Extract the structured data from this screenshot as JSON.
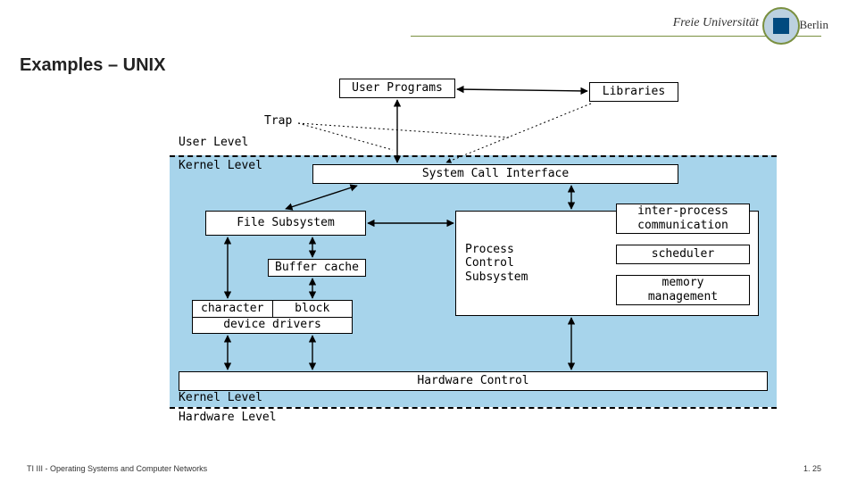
{
  "header": {
    "university": "Freie Universität",
    "city": "Berlin"
  },
  "title": "Examples – UNIX",
  "levels": {
    "user": "User Level",
    "kernel_top": "Kernel Level",
    "kernel_bot": "Kernel Level",
    "hardware": "Hardware Level"
  },
  "trap_label": "Trap",
  "boxes": {
    "user_programs": "User Programs",
    "libraries": "Libraries",
    "syscall": "System Call Interface",
    "file_sub": "File Subsystem",
    "buffer_cache": "Buffer cache",
    "char_drv": "character",
    "block_drv": "block",
    "device_drivers": "device drivers",
    "proc_ctrl": "Process\nControl\nSubsystem",
    "ipc": "inter-process\ncommunication",
    "scheduler": "scheduler",
    "mem_mgmt": "memory\nmanagement",
    "hw_ctrl": "Hardware Control"
  },
  "footer": {
    "left": "TI III - Operating Systems and Computer Networks",
    "right": "1. 25"
  },
  "chart_data": {
    "type": "diagram",
    "title": "UNIX kernel block diagram",
    "layers": [
      "User Level",
      "Kernel Level",
      "Hardware Level"
    ],
    "nodes": [
      {
        "id": "user_programs",
        "layer": "User Level"
      },
      {
        "id": "libraries",
        "layer": "User Level"
      },
      {
        "id": "syscall",
        "layer": "Kernel Level"
      },
      {
        "id": "file_sub",
        "layer": "Kernel Level"
      },
      {
        "id": "buffer_cache",
        "layer": "Kernel Level"
      },
      {
        "id": "device_drivers",
        "layer": "Kernel Level",
        "children": [
          "character",
          "block"
        ]
      },
      {
        "id": "proc_ctrl",
        "layer": "Kernel Level",
        "children": [
          "ipc",
          "scheduler",
          "mem_mgmt"
        ]
      },
      {
        "id": "hw_ctrl",
        "layer": "Kernel Level"
      }
    ],
    "edges": [
      [
        "user_programs",
        "libraries",
        "bidir"
      ],
      [
        "user_programs",
        "syscall",
        "bidir",
        "trap"
      ],
      [
        "libraries",
        "syscall",
        "bidir",
        "trap"
      ],
      [
        "syscall",
        "file_sub",
        "bidir"
      ],
      [
        "syscall",
        "proc_ctrl",
        "bidir"
      ],
      [
        "file_sub",
        "proc_ctrl",
        "bidir"
      ],
      [
        "file_sub",
        "buffer_cache",
        "bidir"
      ],
      [
        "buffer_cache",
        "block",
        "bidir"
      ],
      [
        "file_sub",
        "character",
        "bidir"
      ],
      [
        "character",
        "hw_ctrl",
        "bidir"
      ],
      [
        "block",
        "hw_ctrl",
        "bidir"
      ],
      [
        "proc_ctrl",
        "hw_ctrl",
        "bidir"
      ]
    ]
  }
}
